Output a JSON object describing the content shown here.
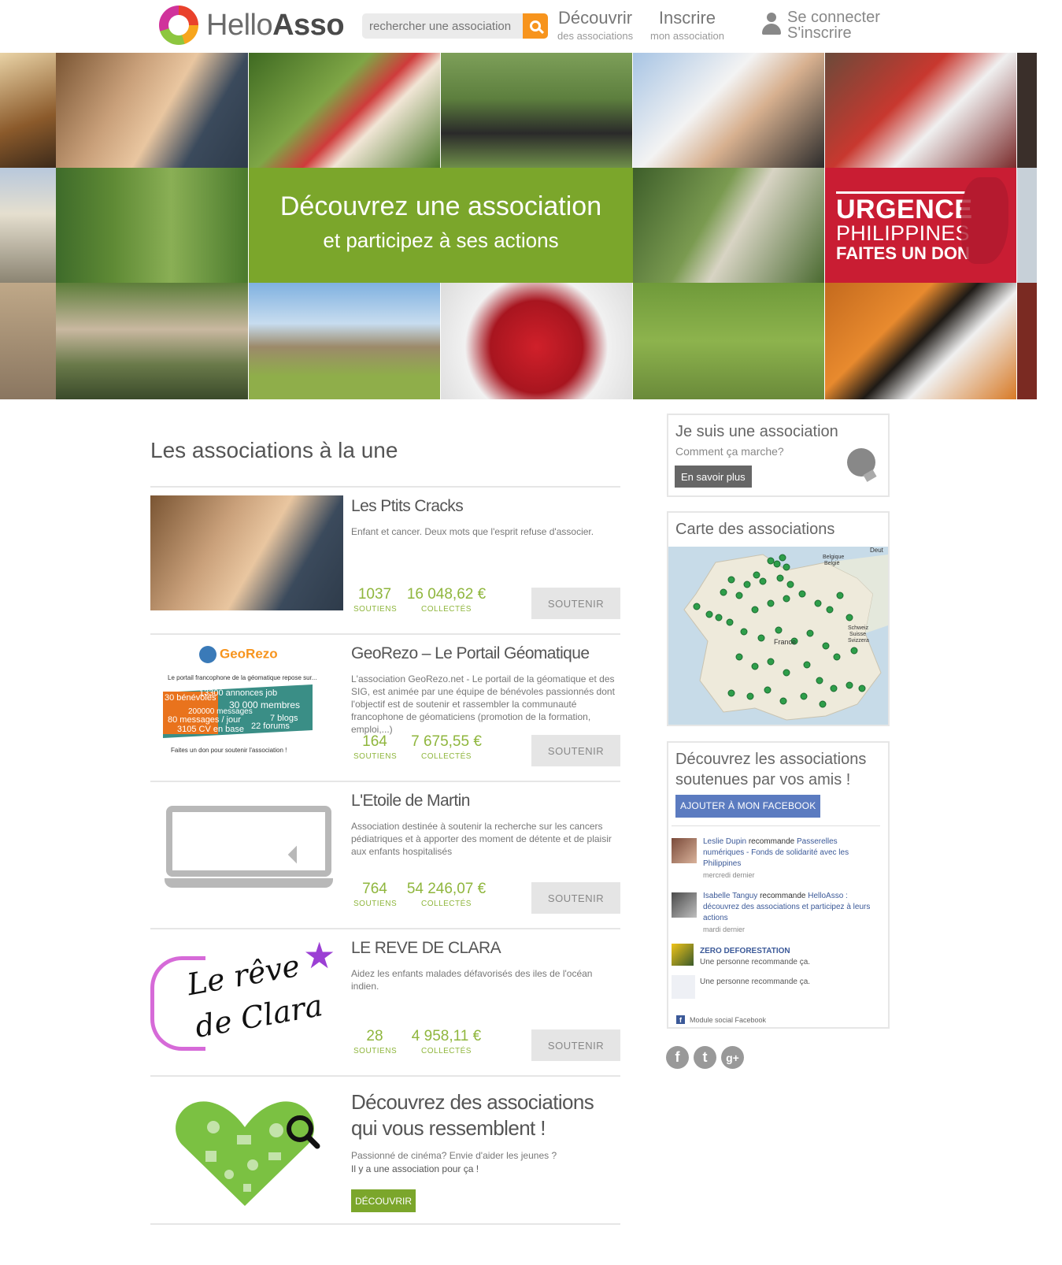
{
  "header": {
    "logo": {
      "light": "Hello",
      "bold": "Asso"
    },
    "search_placeholder": "rechercher une association",
    "nav": [
      {
        "label": "Découvrir",
        "sub": "des associations"
      },
      {
        "label": "Inscrire",
        "sub": "mon association"
      }
    ],
    "login": {
      "connect": "Se connecter",
      "register": "S'inscrire"
    }
  },
  "hero": {
    "promo_title": "Découvrez une association",
    "promo_sub": "et participez à ses actions",
    "urgence": {
      "line1": "URGENCE",
      "line2": "PHILIPPINES",
      "line3": "FAITES UN DON"
    }
  },
  "main": {
    "title": "Les associations à la une",
    "associations": [
      {
        "name": "Les Ptits Cracks",
        "desc": "Enfant et cancer. Deux mots que l'esprit refuse d'associer.",
        "soutiens": "1037",
        "collectes": "16 048,62 €"
      },
      {
        "name": "GeoRezo – Le Portail Géomatique",
        "desc": "L'association GeoRezo.net - Le portail de la géomatique et des SIG, est animée par une équipe de bénévoles passionnés dont l'objectif est de soutenir et rassembler la communauté francophone de géomaticiens (promotion de la formation, emploi,...)",
        "soutiens": "164",
        "collectes": "7 675,55 €"
      },
      {
        "name": "L'Etoile de Martin",
        "desc": "Association destinée à soutenir la recherche sur les cancers pédiatriques et à apporter des moment de détente et de plaisir aux enfants hospitalisés",
        "soutiens": "764",
        "collectes": "54 246,07 €"
      },
      {
        "name": "LE REVE DE CLARA",
        "desc": "Aidez les enfants malades défavorisés des iles de l'océan indien.",
        "soutiens": "28",
        "collectes": "4 958,11 €"
      }
    ],
    "labels": {
      "soutiens": "SOUTIENS",
      "collectes": "COLLECTÉS",
      "soutenir": "SOUTENIR"
    },
    "georezo_img": {
      "title": "GeoRezo",
      "tagline": "Le portail francophone de la géomatique repose sur...",
      "s1": "30 bénévoles",
      "s2": "13300 annonces job",
      "s3": "30 000 membres",
      "s4": "200000 messages",
      "s5": "80 messages / jour",
      "s6": "7 blogs",
      "s7": "3105 CV en base",
      "s8": "22 forums",
      "footer": "Faites un don pour soutenir l'association !"
    },
    "clara_img": {
      "line1": "Le rêve",
      "line2": "de Clara"
    },
    "discover": {
      "title1": "Découvrez des associations",
      "title2": "qui vous ressemblent !",
      "text1": "Passionné de cinéma? Envie d'aider les jeunes ?",
      "text2": "Il y a une association pour ça !",
      "button": "DÉCOUVRIR"
    }
  },
  "sidebar": {
    "asso_box": {
      "title": "Je suis une association",
      "sub": "Comment ça marche?",
      "button": "En savoir plus"
    },
    "map_box": {
      "title": "Carte des associations",
      "labels": [
        "Belgique",
        "België",
        "France",
        "Schweiz",
        "Suisse",
        "Svizzera",
        "Deut"
      ]
    },
    "fb_box": {
      "title1": "Découvrez les associations",
      "title2": "soutenues par vos amis !",
      "button": "AJOUTER À MON FACEBOOK",
      "items": [
        {
          "name": "Leslie Dupin",
          "text": "recommande",
          "target": "Passerelles numériques - Fonds de solidarité avec les Philippines",
          "time": "mercredi dernier"
        },
        {
          "name": "Isabelle Tanguy",
          "text": "recommande",
          "target": "HelloAsso : découvrez des associations et participez à leurs actions",
          "time": "mardi dernier"
        },
        {
          "name": "ZERO DEFORESTATION",
          "text": "Une personne recommande ça.",
          "target": "",
          "time": ""
        },
        {
          "name": "",
          "text": "Une personne recommande ça.",
          "target": "",
          "time": ""
        }
      ],
      "footer": "Module social Facebook"
    },
    "social": [
      "f",
      "t",
      "g+"
    ]
  },
  "colors": {
    "green": "#7ba62b",
    "orange": "#f7941d",
    "red": "#c91d33",
    "stat_green": "#8fb63d",
    "facebook": "#5b7bc0"
  }
}
